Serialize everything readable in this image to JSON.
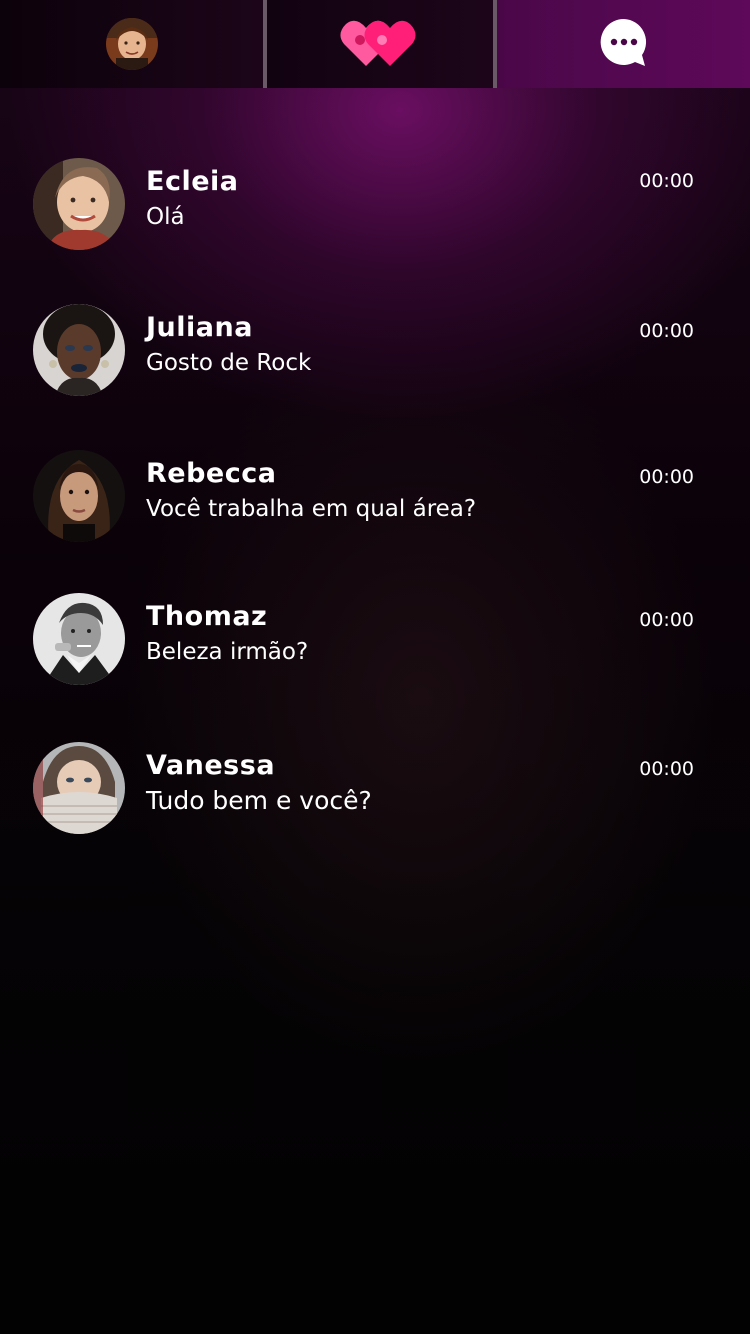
{
  "tabs": [
    {
      "id": "profile",
      "icon": "user-avatar-icon"
    },
    {
      "id": "matches",
      "icon": "double-heart-icon"
    },
    {
      "id": "chat",
      "icon": "chat-bubble-icon",
      "active": true
    }
  ],
  "colors": {
    "active_tab": "#5e095a",
    "heart": "#ff1f78",
    "heart_back": "#ff5aa0"
  },
  "conversations": [
    {
      "name": "Ecleia",
      "message": "Olá",
      "time": "00:00"
    },
    {
      "name": "Juliana",
      "message": "Gosto de Rock",
      "time": "00:00"
    },
    {
      "name": "Rebecca",
      "message": "Você trabalha em qual área?",
      "time": "00:00"
    },
    {
      "name": "Thomaz",
      "message": "Beleza irmão?",
      "time": "00:00"
    },
    {
      "name": "Vanessa",
      "message": "Tudo bem e você?",
      "time": "00:00"
    }
  ]
}
